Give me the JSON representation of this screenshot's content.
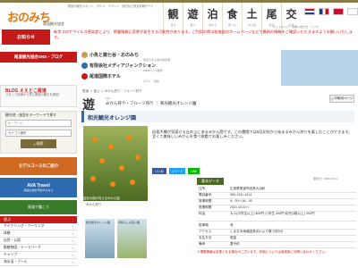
{
  "header": {
    "logo_text": "おのみち",
    "logo_sub": "尾道観光協会",
    "tagline": "尾道の観光スポット、グルメ、イベント、宿泊など総合情報サイト",
    "nav": [
      {
        "k": "観",
        "s": "見る"
      },
      {
        "k": "遊",
        "s": "遊ぶ"
      },
      {
        "k": "泊",
        "s": "泊まる"
      },
      {
        "k": "食",
        "s": "食べる"
      },
      {
        "k": "土",
        "s": "お土産"
      },
      {
        "k": "尾",
        "s": "尾道"
      },
      {
        "k": "交",
        "s": "交通"
      }
    ],
    "flag_colors": [
      "#1d3c8c",
      "#c8102e",
      "#ffffff",
      "#e6e6e6"
    ],
    "util": "サイトマップ　お問い合わせ　リンク"
  },
  "notice": {
    "label": "お知らせ",
    "text": "新型コロナウイルス感染症により、掲載情報に変更が発生する可能性があります。ご利用の際は各施設のホームページなどで最新の情報をご確認いただきますようお願いいたします。"
  },
  "left": {
    "sns": "尾道観光協会SNS・ブログ",
    "blog_title": "BLOG ええとこ尾道",
    "blog_desc": "スタッフ目線から見た尾道の魅力を発信！",
    "search_label": "観光地・施設をキーワードで探す",
    "search_placeholder": "キーワード",
    "search_select": "カテゴリ選択",
    "search_button": "検索",
    "banner1": "モデルコースのご紹介",
    "banner2_title": "AVA Travel",
    "banner2_sub": "尾道の旅を予約するなら",
    "banner3": "尾道で働こう",
    "cat_head": "遊ぶ",
    "categories": [
      "サイクリング・ツーリング",
      "体験",
      "自然・公園",
      "動植物園・テーマパーク",
      "キャンプ",
      "海水浴・プール"
    ]
  },
  "sponsor": [
    {
      "title": "小魚と築七谷・おのみち",
      "sub": "尾道のお土産は尾道港…"
    },
    {
      "title": "有限会社メディアジャンクション",
      "sub": "WEBサイト制作"
    },
    {
      "title": "尾道国際ホテル",
      "sub": "ホテル・旅館"
    }
  ],
  "breadcrumb": "尾道 ＞ 遊ぶ ＞ みかん狩り・フルーツ狩り",
  "category": {
    "title": "遊",
    "en": "Play",
    "crumb": "みかん狩り・フルーツ狩り ｜ 和光観光オレンジ園"
  },
  "print_label": "印刷用ページ",
  "spot_title": "和光観光オレンジ園",
  "photo_caption": "因島大橋が見えるみかん園",
  "photo_label": "みかん狩り",
  "thumbs": [
    "和光観光オレンジ園",
    "見晴らしの良い園"
  ],
  "description": "因島大橋が見渡せる丘の上にあるみかん園です。この農園では9月初旬から始まるみかん狩りを楽しむことができます。甘くて美味しいみかんを食べ放題でお楽しみください。",
  "share": [
    {
      "label": "いいね",
      "color": "#3b5998"
    },
    {
      "label": "ツイート",
      "color": "#1da1f2"
    },
    {
      "label": "LINE",
      "color": "#00b900"
    }
  ],
  "updated": "更新日：2021.03.01",
  "info_head": "基本データ",
  "info": [
    {
      "k": "住所",
      "v": "広島県尾道市因島大浜町"
    },
    {
      "k": "電話番号",
      "v": "090-1311-1414"
    },
    {
      "k": "営業時間",
      "v": "9：00～16：00"
    },
    {
      "k": "営業期間",
      "v": "2021.10.01～"
    },
    {
      "k": "料金",
      "v": "大人(中学生以上) 600円 小学生 400円 幼児(3歳以上) 300円"
    },
    {
      "k": "駐車場",
      "v": "有"
    },
    {
      "k": "アクセス",
      "v": "しまなみ海道因島北ICより車で約5分"
    },
    {
      "k": "支払方法",
      "v": "現金"
    },
    {
      "k": "備考",
      "v": "要予約"
    }
  ],
  "footer_note": "※掲載情報は変更となる場合がございます。詳細については各施設にお問い合わせください。"
}
